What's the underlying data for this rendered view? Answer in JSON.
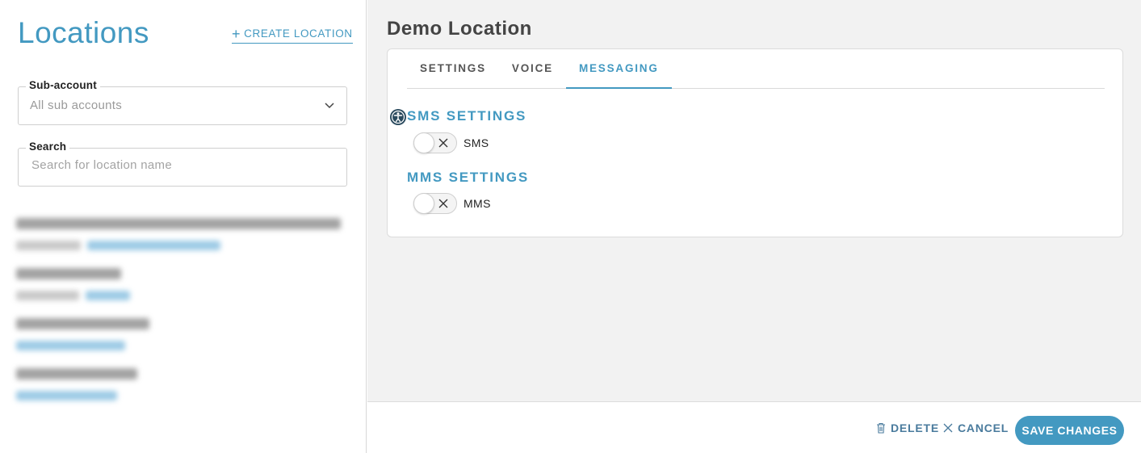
{
  "sidebar": {
    "title": "Locations",
    "create_label": "CREATE LOCATION",
    "subaccount": {
      "label": "Sub-account",
      "value": "All sub accounts"
    },
    "search": {
      "label": "Search",
      "placeholder": "Search for location name"
    }
  },
  "detail": {
    "title": "Demo Location",
    "tabs": [
      {
        "label": "SETTINGS",
        "active": false
      },
      {
        "label": "VOICE",
        "active": false
      },
      {
        "label": "MESSAGING",
        "active": true
      }
    ],
    "sms": {
      "title": "SMS SETTINGS",
      "toggle_label": "SMS",
      "enabled": false
    },
    "mms": {
      "title": "MMS SETTINGS",
      "toggle_label": "MMS",
      "enabled": false
    }
  },
  "footer": {
    "delete_label": "DELETE",
    "cancel_label": "CANCEL",
    "save_label": "SAVE CHANGES"
  },
  "colors": {
    "accent": "#4399c1",
    "panel_bg": "#f2f2f2",
    "secondary_text": "#4a7b9d"
  }
}
